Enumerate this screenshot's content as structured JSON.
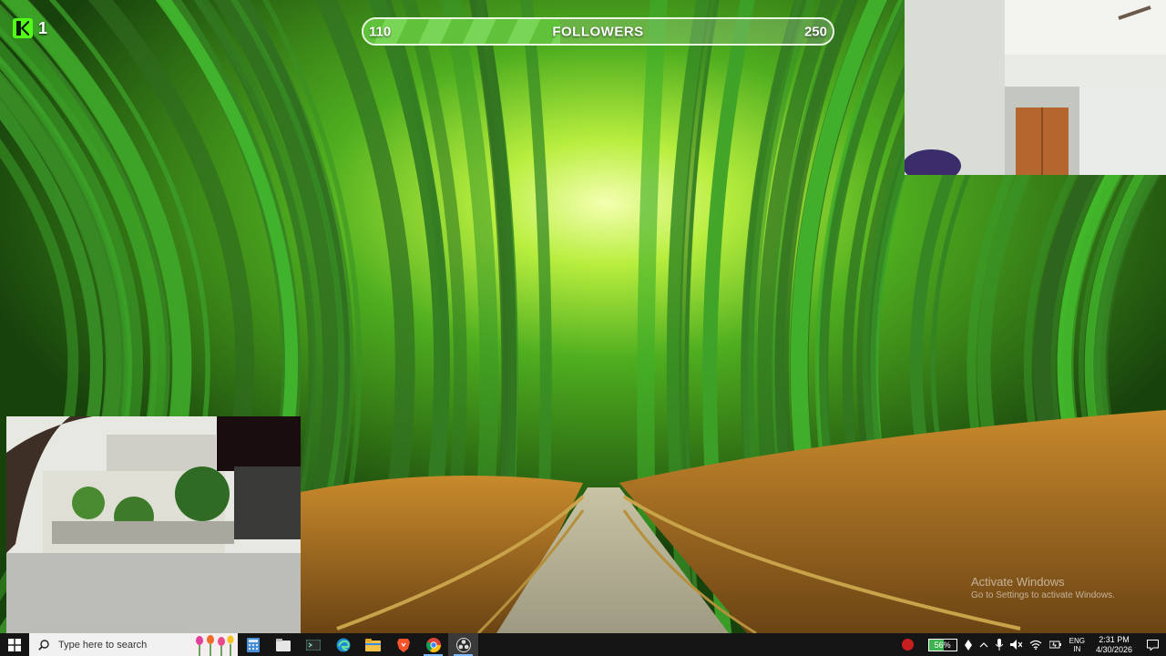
{
  "overlay": {
    "kick_count": "1",
    "goal": {
      "start": "110",
      "label": "FOLLOWERS",
      "end": "250",
      "progress": 0.42
    }
  },
  "watermark": {
    "title": "Activate Windows",
    "subtitle": "Go to Settings to activate Windows."
  },
  "taskbar": {
    "search_placeholder": "Type here to search",
    "apps": [
      "calculator-icon",
      "files-icon",
      "terminal-icon",
      "edge-icon",
      "file-explorer-icon",
      "brave-icon",
      "chrome-icon",
      "obs-icon"
    ],
    "tray": {
      "battery": "56%",
      "language": "ENG",
      "region": "IN",
      "time": "2:31 PM",
      "date": "4/30/2026"
    }
  },
  "colors": {
    "accent_green": "#53fc18",
    "goal_fill": "#6acb46",
    "taskbar_bg": "#151515"
  }
}
